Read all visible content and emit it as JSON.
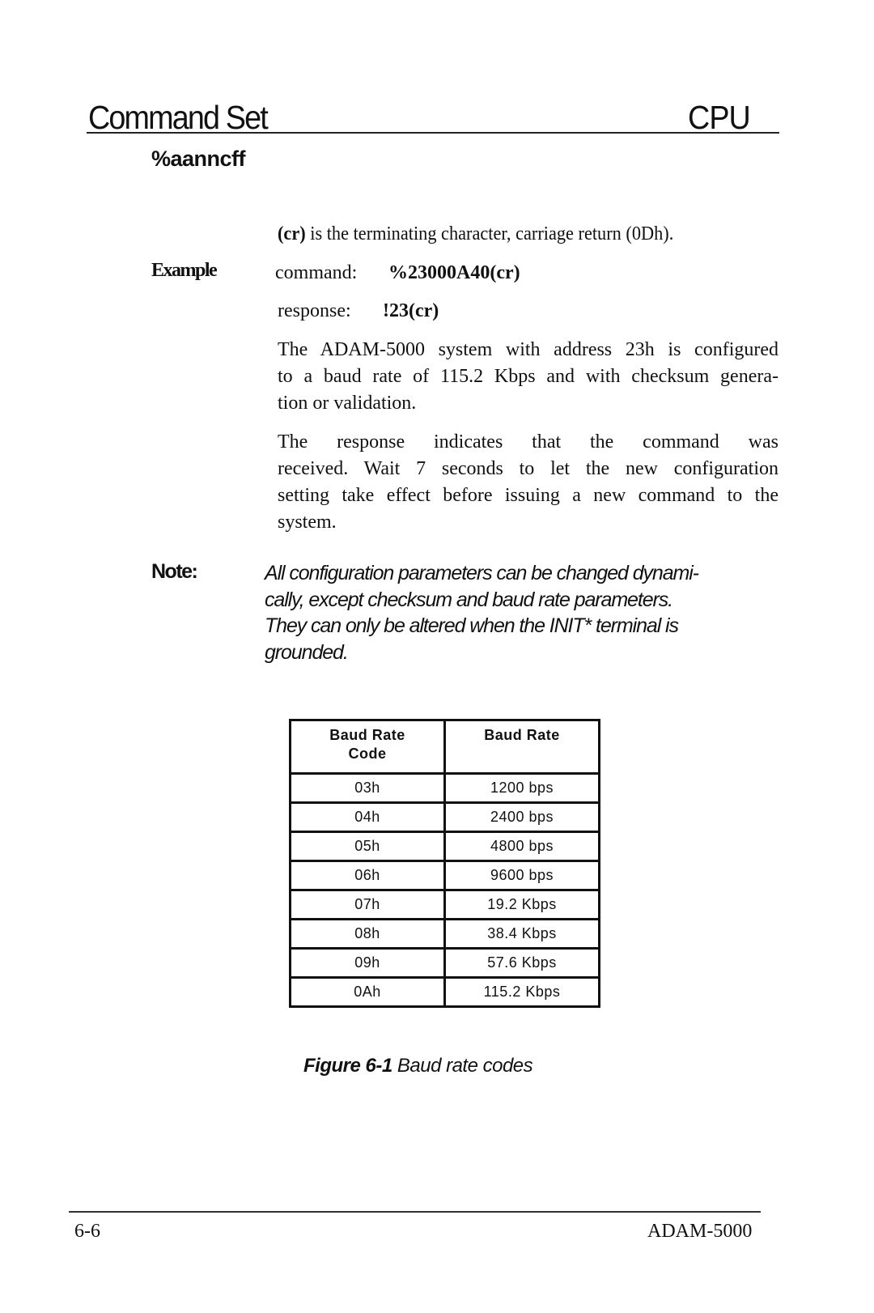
{
  "header": {
    "title": "Command Set",
    "section": "CPU"
  },
  "command_syntax": "%aanncff",
  "cr_note": {
    "term": "(cr)",
    "text": " is the terminating character, carriage return (0Dh)."
  },
  "example": {
    "label": "Example",
    "command_label": "command:",
    "command_value": "%23000A40(cr)",
    "response_label": "response:",
    "response_value": "!23(cr)"
  },
  "paragraphs": [
    "The ADAM-5000 system with address 23h is configured to a baud rate of 115.2 Kbps and with checksum generation or validation.",
    "The response indicates that the command was received. Wait 7 seconds to let the new configuration setting take effect before issuing a new command to the system."
  ],
  "paragraph_lines": {
    "p1": [
      "The ADAM-5000 system with address 23h is configured",
      "to a baud rate of 115.2 Kbps and with checksum genera-",
      "tion or validation."
    ],
    "p2": [
      "The response indicates that the command was",
      "received. Wait 7 seconds to let the new configuration",
      "setting take effect before issuing a new command to the",
      "system."
    ]
  },
  "note": {
    "label": "Note:",
    "lines": [
      "All configuration parameters can be changed dynami-",
      "cally, except checksum and baud rate parameters.",
      "They can only be altered when the INIT* terminal is",
      "grounded."
    ]
  },
  "table": {
    "headers": [
      "Baud Rate\nCode",
      "Baud Rate"
    ],
    "header_lines": [
      [
        "Baud Rate",
        "Code"
      ],
      [
        "Baud Rate"
      ]
    ],
    "rows": [
      [
        "03h",
        "1200 bps"
      ],
      [
        "04h",
        "2400 bps"
      ],
      [
        "05h",
        "4800 bps"
      ],
      [
        "06h",
        "9600 bps"
      ],
      [
        "07h",
        "19.2 Kbps"
      ],
      [
        "08h",
        "38.4 Kbps"
      ],
      [
        "09h",
        "57.6 Kbps"
      ],
      [
        "0Ah",
        "115.2 Kbps"
      ]
    ]
  },
  "figure": {
    "number": "Figure 6-1",
    "caption": " Baud rate codes"
  },
  "footer": {
    "page": "6-6",
    "product": "ADAM-5000"
  }
}
